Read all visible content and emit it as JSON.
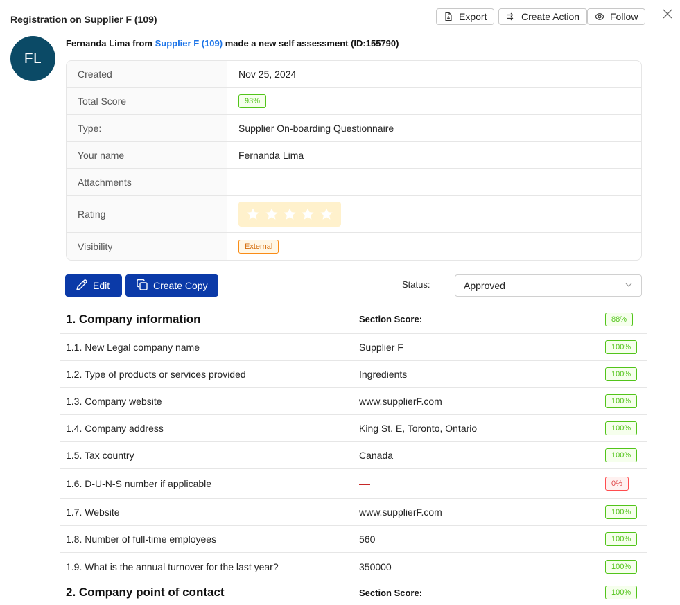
{
  "header": {
    "title": "Registration on Supplier F (109)",
    "export_label": "Export",
    "create_action_label": "Create Action",
    "follow_label": "Follow"
  },
  "avatar": {
    "initials": "FL",
    "color": "#0b4a66"
  },
  "headline": {
    "prefix": "Fernanda Lima from ",
    "link": "Supplier F (109)",
    "suffix": " made a new self assessment (ID:155790)"
  },
  "details": {
    "created_label": "Created",
    "created_value": "Nov 25, 2024",
    "total_score_label": "Total Score",
    "total_score_value": "93%",
    "type_label": "Type:",
    "type_value": "Supplier On-boarding Questionnaire",
    "your_name_label": "Your name",
    "your_name_value": "Fernanda Lima",
    "attachments_label": "Attachments",
    "attachments_value": "",
    "rating_label": "Rating",
    "rating_stars_total": 5,
    "visibility_label": "Visibility",
    "visibility_value": "External"
  },
  "actions": {
    "edit_label": "Edit",
    "create_copy_label": "Create Copy",
    "status_label": "Status:",
    "status_value": "Approved"
  },
  "sections": [
    {
      "title": "1. Company information",
      "score_label": "Section Score:",
      "score": "88%",
      "questions": [
        {
          "q": "1.1. New Legal company name",
          "a": "Supplier F",
          "score": "100%"
        },
        {
          "q": "1.2. Type of products or services provided",
          "a": "Ingredients",
          "score": "100%"
        },
        {
          "q": "1.3. Company website",
          "a": "www.supplierF.com",
          "score": "100%"
        },
        {
          "q": "1.4. Company address",
          "a": "King St. E, Toronto, Ontario",
          "score": "100%"
        },
        {
          "q": "1.5. Tax country",
          "a": "Canada",
          "score": "100%"
        },
        {
          "q": "1.6. D-U-N-S number if applicable",
          "a": "",
          "score": "0%"
        },
        {
          "q": "1.7. Website",
          "a": "www.supplierF.com",
          "score": "100%"
        },
        {
          "q": "1.8. Number of full-time employees",
          "a": "560",
          "score": "100%"
        },
        {
          "q": "1.9. What is the annual turnover for the last year?",
          "a": "350000",
          "score": "100%"
        }
      ]
    },
    {
      "title": "2. Company point of contact",
      "score_label": "Section Score:",
      "score": "100%"
    }
  ],
  "colors": {
    "primary": "#0b3aa8",
    "link": "#1a73e8",
    "success": "#52c41a",
    "danger": "#ff4d4f",
    "warning": "#fa8c16",
    "star_bg": "#fff1cc"
  }
}
